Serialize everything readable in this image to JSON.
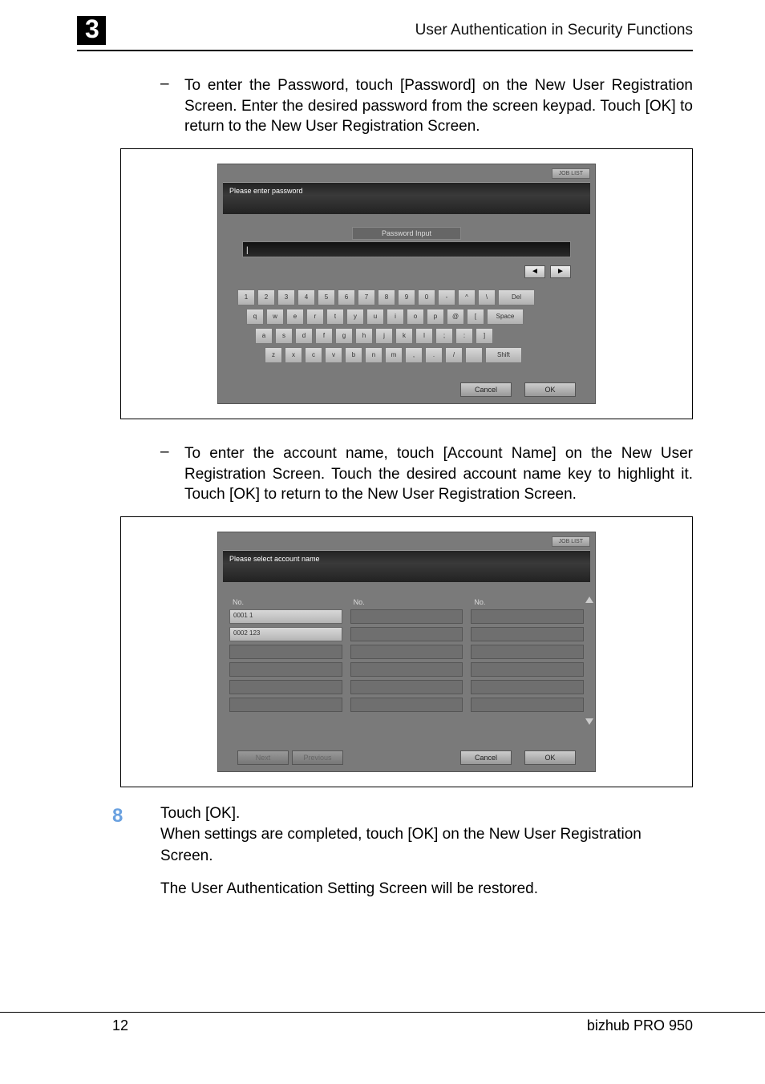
{
  "header": {
    "chapter_number": "3",
    "title": "User Authentication in Security Functions"
  },
  "bullets": {
    "dash": "–",
    "password_text": "To enter the Password, touch [Password] on the New User Registration Screen. Enter the desired password from the screen keypad. Touch [OK] to return to the New User Registration Screen.",
    "account_text": "To enter the account name, touch [Account Name] on the New User Registration Screen. Touch the desired account name key to highlight it. Touch [OK] to return to the New User Registration Screen."
  },
  "screen1": {
    "job_tab": "JOB LIST",
    "message": "Please enter password",
    "input_header": "Password Input",
    "cursor": "|",
    "arrows": {
      "left": "◄",
      "right": "►"
    },
    "keys": {
      "row1": [
        "1",
        "2",
        "3",
        "4",
        "5",
        "6",
        "7",
        "8",
        "9",
        "0",
        "-",
        "^",
        "\\"
      ],
      "row1_del": "Del",
      "row2": [
        "q",
        "w",
        "e",
        "r",
        "t",
        "y",
        "u",
        "i",
        "o",
        "p",
        "@",
        "["
      ],
      "row2_space": "Space",
      "row3": [
        "a",
        "s",
        "d",
        "f",
        "g",
        "h",
        "j",
        "k",
        "l",
        ";",
        ":",
        "]"
      ],
      "row4": [
        "z",
        "x",
        "c",
        "v",
        "b",
        "n",
        "m",
        ",",
        ".",
        "/",
        " "
      ],
      "row4_shift": "Shift"
    },
    "cancel": "Cancel",
    "ok": "OK"
  },
  "screen2": {
    "job_tab": "JOB LIST",
    "message": "Please select account name",
    "col_header": "No.",
    "items": [
      "0001 1",
      "0002 123"
    ],
    "next": "Next",
    "previous": "Previous",
    "cancel": "Cancel",
    "ok": "OK"
  },
  "step8": {
    "num": "8",
    "line1": "Touch [OK].",
    "line2": "When settings are completed, touch [OK] on the New User Registration Screen.",
    "line3": "The User Authentication Setting Screen will be restored."
  },
  "footer": {
    "page": "12",
    "product": "bizhub PRO 950"
  }
}
